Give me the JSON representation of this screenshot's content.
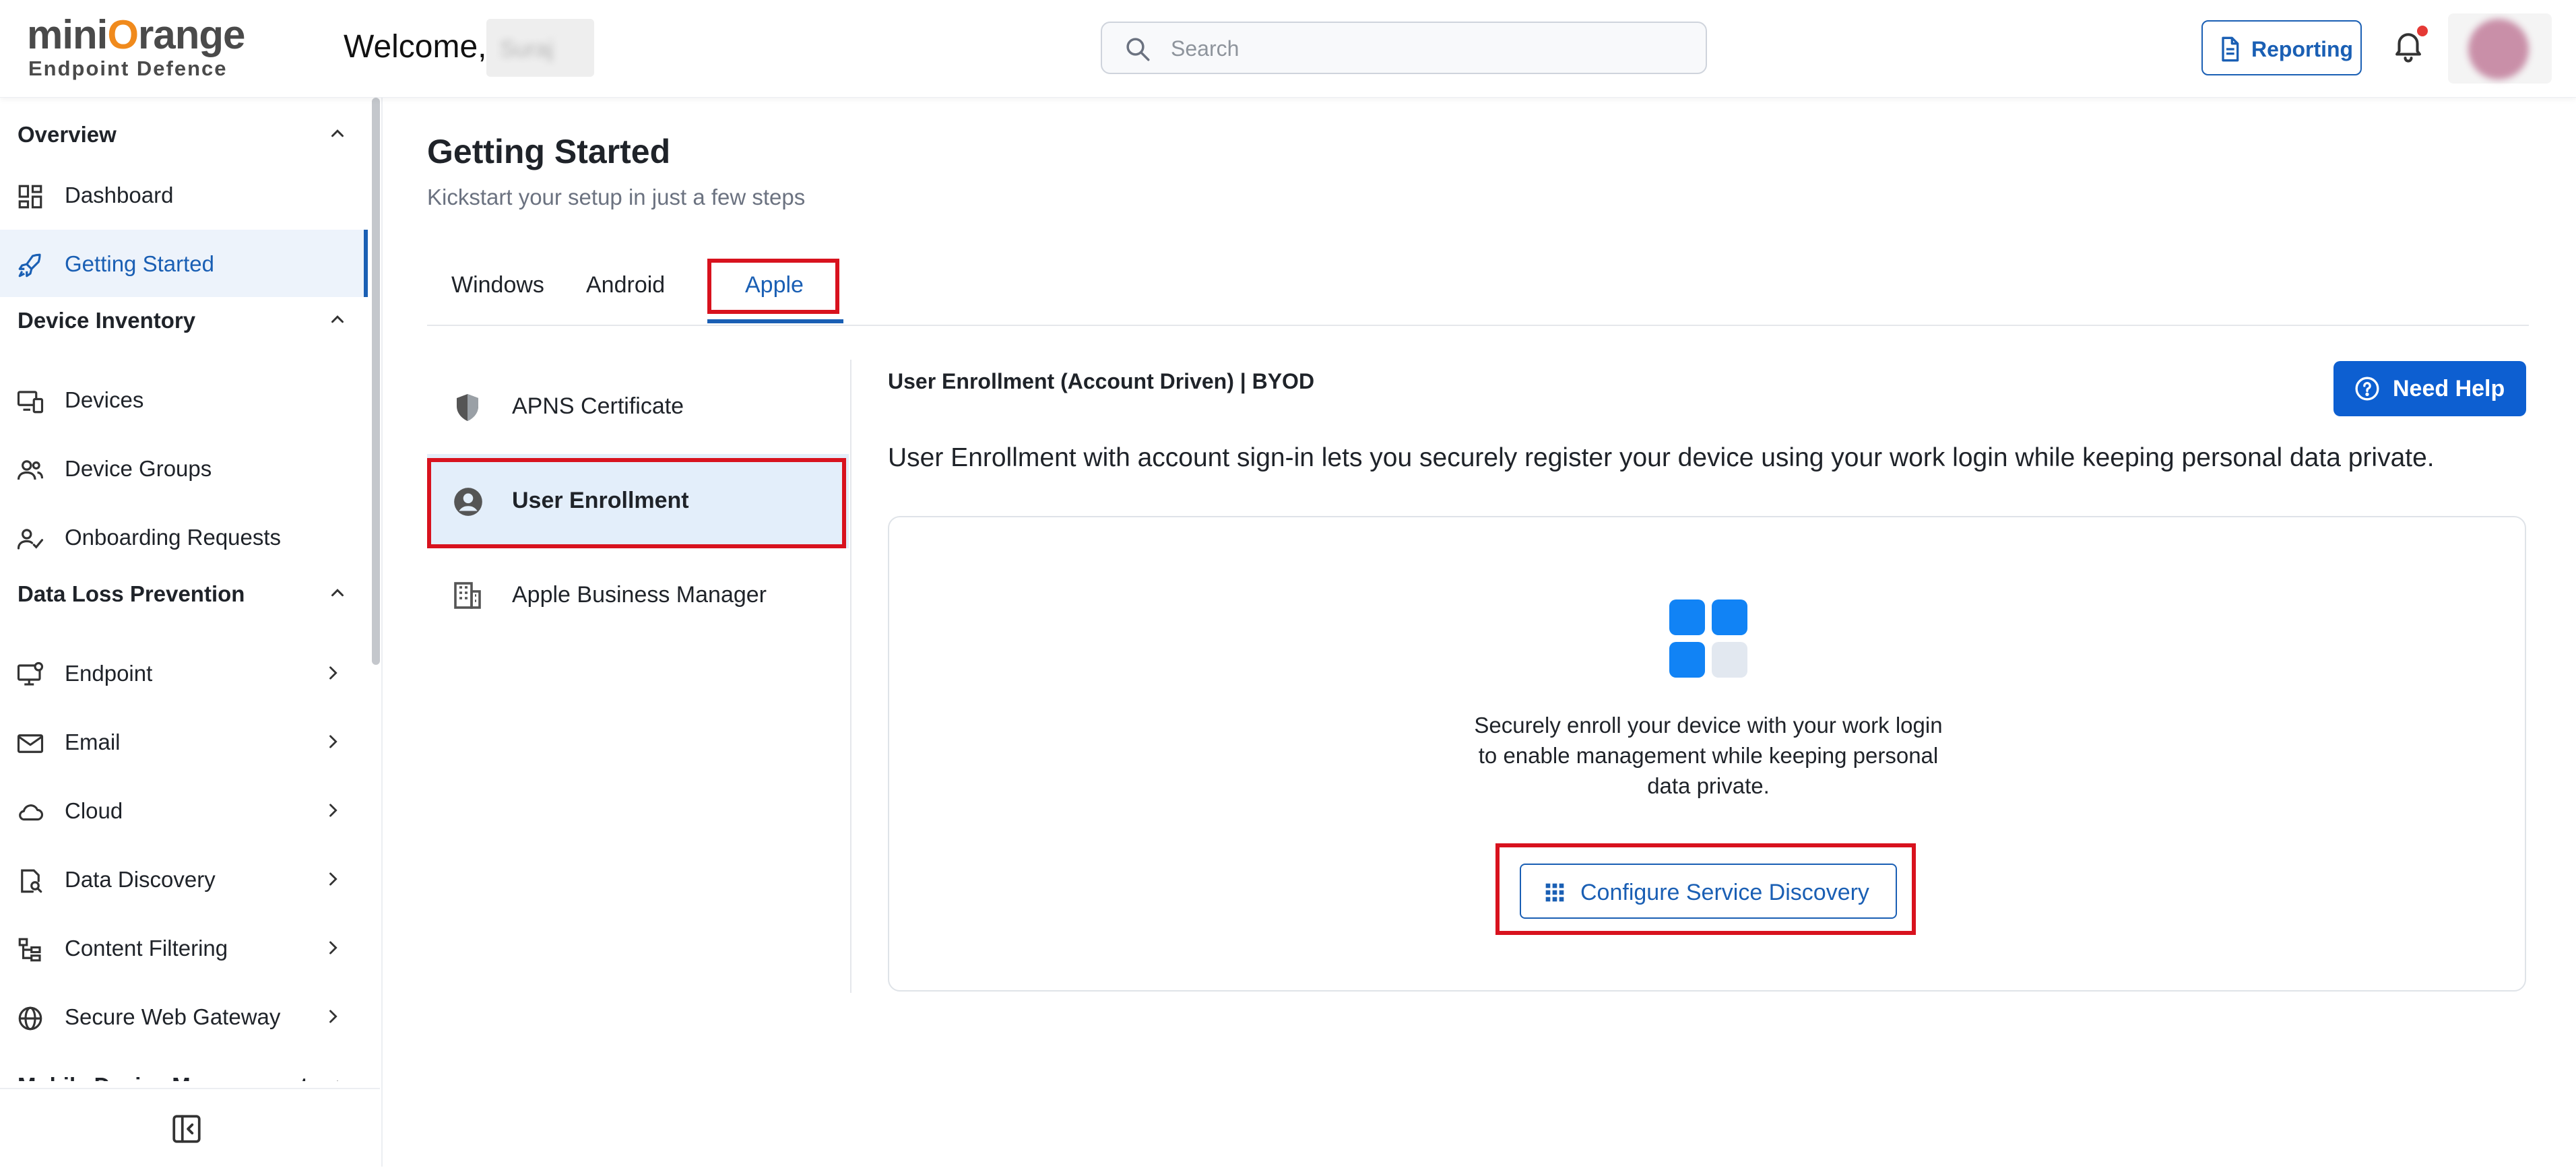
{
  "header": {
    "logo_top_part1": "mini",
    "logo_top_o": "O",
    "logo_top_part2": "range",
    "logo_bottom": "Endpoint Defence",
    "welcome": "Welcome,",
    "welcome_name": "Suraj",
    "search_placeholder": "Search",
    "reporting_label": "Reporting",
    "icons": {
      "search": "search-icon",
      "reporting": "document-icon",
      "bell": "bell-icon"
    },
    "notification_dot_color": "#e53935"
  },
  "sidebar": {
    "sections": [
      {
        "title": "Overview",
        "expanded": true
      },
      {
        "title": "Device Inventory",
        "expanded": true
      },
      {
        "title": "Data Loss Prevention",
        "expanded": true
      },
      {
        "title": "Mobile Device Management",
        "expanded": true
      }
    ],
    "items": [
      {
        "label": "Dashboard",
        "icon": "dashboard-icon",
        "active": false
      },
      {
        "label": "Getting Started",
        "icon": "rocket-icon",
        "active": true
      },
      {
        "label": "Devices",
        "icon": "devices-icon"
      },
      {
        "label": "Device Groups",
        "icon": "users-icon"
      },
      {
        "label": "Onboarding Requests",
        "icon": "user-check-icon"
      },
      {
        "label": "Endpoint",
        "icon": "monitor-icon",
        "has_children": true
      },
      {
        "label": "Email",
        "icon": "mail-icon",
        "has_children": true
      },
      {
        "label": "Cloud",
        "icon": "cloud-icon",
        "has_children": true
      },
      {
        "label": "Data Discovery",
        "icon": "file-search-icon",
        "has_children": true
      },
      {
        "label": "Content Filtering",
        "icon": "filter-tree-icon",
        "has_children": true
      },
      {
        "label": "Secure Web Gateway",
        "icon": "globe-icon",
        "has_children": true
      }
    ],
    "collapse_icon": "collapse-sidebar-icon"
  },
  "main": {
    "title": "Getting Started",
    "subtitle": "Kickstart your setup in just a few steps",
    "tabs": [
      {
        "label": "Windows",
        "active": false
      },
      {
        "label": "Android",
        "active": false
      },
      {
        "label": "Apple",
        "active": true
      }
    ],
    "left_menu": [
      {
        "label": "APNS Certificate",
        "icon": "shield-icon",
        "active": false
      },
      {
        "label": "User Enrollment",
        "icon": "user-circle-icon",
        "active": true
      },
      {
        "label": "Apple Business Manager",
        "icon": "building-icon",
        "active": false
      }
    ],
    "section_title": "User Enrollment (Account Driven) | BYOD",
    "need_help_label": "Need Help",
    "description": "User Enrollment with account sign-in lets you securely register your device using your work login while keeping personal data private.",
    "card": {
      "icon": "apps-grid-icon",
      "text": "Securely enroll your device with your work login to enable management while keeping personal data private.",
      "button_label": "Configure Service Discovery",
      "button_icon": "grid-dots-icon"
    }
  },
  "colors": {
    "accent": "#1a5fb4",
    "primary_button": "#0d5fd1",
    "highlight_box": "#d8121e",
    "active_bg": "#edf3fb",
    "logo_orange": "#f08a1c"
  }
}
